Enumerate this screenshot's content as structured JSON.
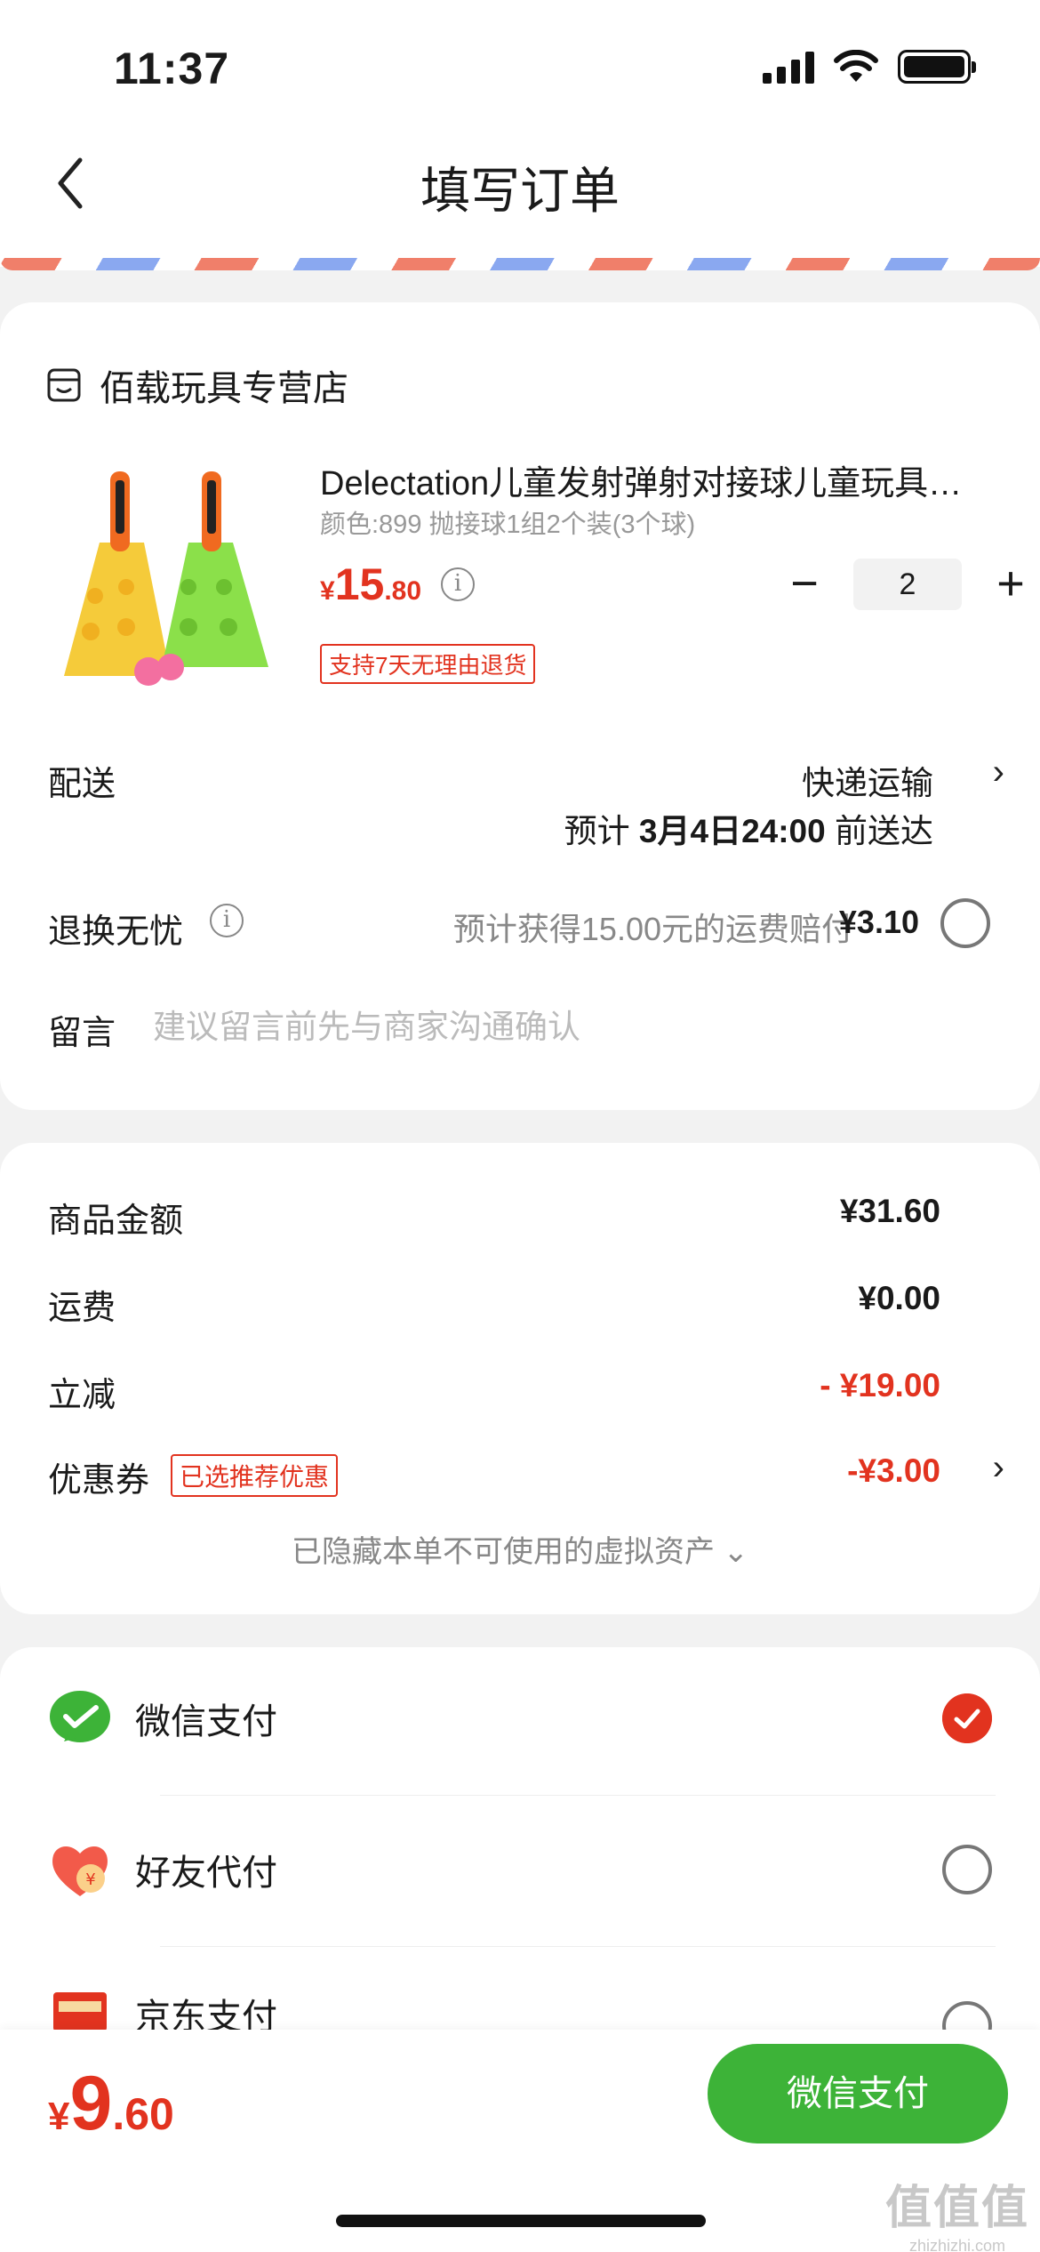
{
  "status": {
    "time": "11:37"
  },
  "nav": {
    "title": "填写订单"
  },
  "shop": {
    "name": "佰载玩具专营店"
  },
  "product": {
    "name": "Delectation儿童发射弹射对接球儿童玩具亲子互动游戏",
    "spec": "颜色:899 抛接球1组2个装(3个球)",
    "price_yen": "¥",
    "price_int": "15",
    "price_dec": ".80",
    "quantity": "2",
    "return_tag": "支持7天无理由退货"
  },
  "delivery": {
    "label": "配送",
    "method": "快递运输",
    "eta_prefix": "预计",
    "eta_date": "3月4日24:00",
    "eta_suffix": "前送达"
  },
  "exchange": {
    "label": "退换无忧",
    "desc": "预计获得15.00元的运费赔付",
    "price": "¥3.10"
  },
  "message": {
    "label": "留言",
    "placeholder": "建议留言前先与商家沟通确认"
  },
  "fees": {
    "goods_label": "商品金额",
    "goods_value": "¥31.60",
    "ship_label": "运费",
    "ship_value": "¥0.00",
    "discount_label": "立减",
    "discount_value": "- ¥19.00",
    "coupon_label": "优惠券",
    "coupon_tag": "已选推荐优惠",
    "coupon_value": "-¥3.00",
    "hidden_assets": "已隐藏本单不可使用的虚拟资产 ⌄"
  },
  "payment": {
    "methods": [
      {
        "label": "微信支付",
        "selected": true
      },
      {
        "label": "好友代付",
        "selected": false
      },
      {
        "label": "京东支付",
        "selected": false
      }
    ]
  },
  "bottom": {
    "total_yen": "¥",
    "total_int": "9",
    "total_dec": ".60",
    "pay_button": "微信支付"
  },
  "watermark": {
    "big": "值值值",
    "small": "zhizhizhi.com"
  },
  "colors": {
    "accent_red": "#e2331f",
    "wechat_green": "#3db338"
  }
}
